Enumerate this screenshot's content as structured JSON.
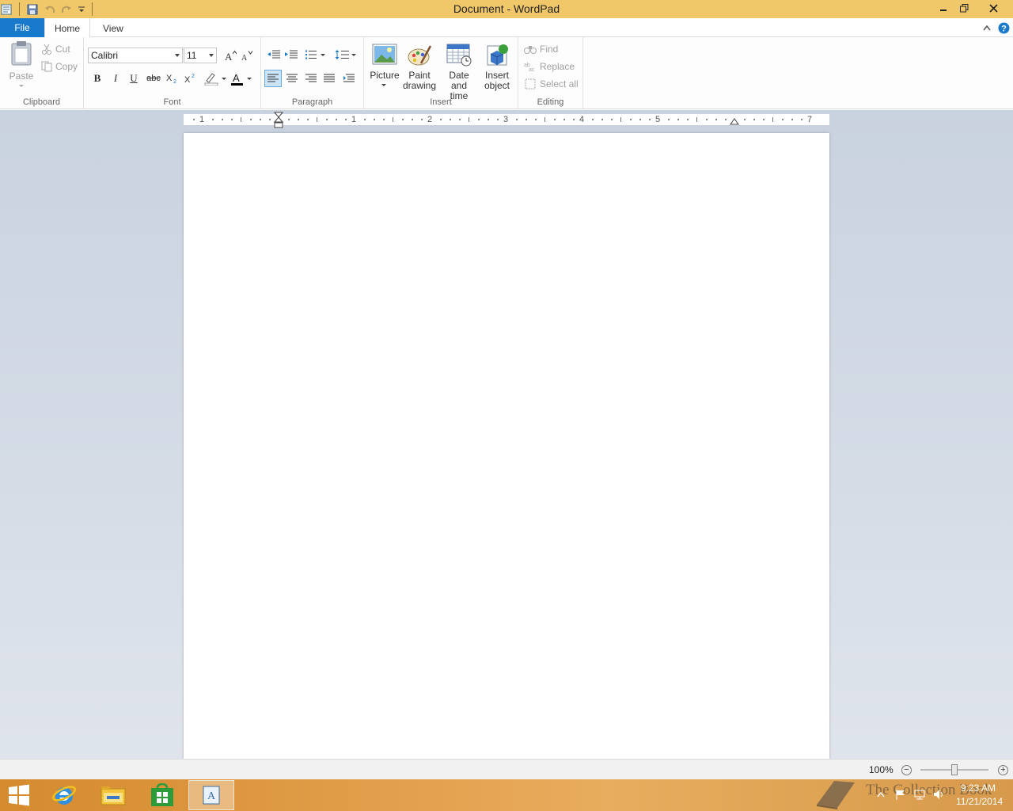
{
  "window": {
    "title": "Document - WordPad"
  },
  "tabs": {
    "file": "File",
    "home": "Home",
    "view": "View"
  },
  "clipboard": {
    "paste": "Paste",
    "cut": "Cut",
    "copy": "Copy",
    "label": "Clipboard"
  },
  "font": {
    "family": "Calibri",
    "size": "11",
    "label": "Font",
    "bold": "B",
    "italic": "I",
    "underline": "U",
    "strike": "abc"
  },
  "paragraph": {
    "label": "Paragraph"
  },
  "insert": {
    "picture": "Picture",
    "paint_line1": "Paint",
    "paint_line2": "drawing",
    "date_line1": "Date and",
    "date_line2": "time",
    "object_line1": "Insert",
    "object_line2": "object",
    "label": "Insert"
  },
  "editing": {
    "find": "Find",
    "replace": "Replace",
    "select_all": "Select all",
    "label": "Editing"
  },
  "ruler": {
    "numbers": [
      "1",
      "1",
      "2",
      "3",
      "4",
      "5",
      "6",
      "7"
    ]
  },
  "status": {
    "zoom": "100%"
  },
  "taskbar": {
    "watermark": "The Collection Book",
    "time": "9:23 AM",
    "date": "11/21/2014"
  },
  "colors": {
    "titlebar": "#f0c869",
    "file_tab": "#1979ca",
    "font_color_underline": "#000000",
    "highlight_underline": "#ffffff"
  }
}
